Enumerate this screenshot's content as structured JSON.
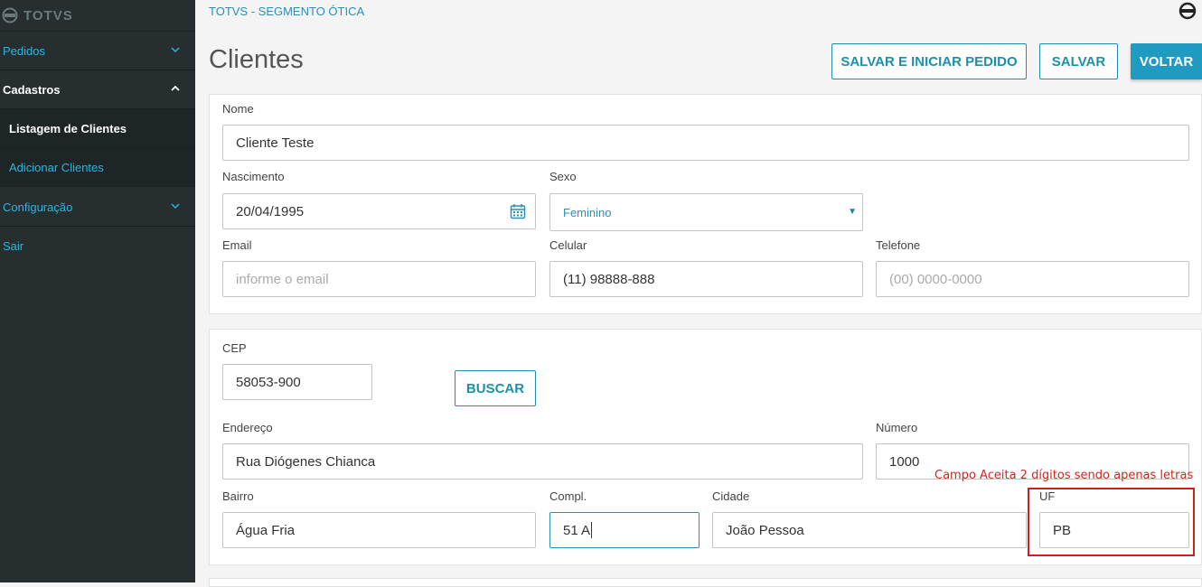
{
  "app": {
    "logo_text": "TOTVS",
    "brand": "TOTVS - SEGMENTO ÓTICA"
  },
  "sidebar": {
    "items": [
      {
        "label": "Pedidos"
      },
      {
        "label": "Cadastros"
      },
      {
        "label": "Listagem de Clientes"
      },
      {
        "label": "Adicionar Clientes"
      },
      {
        "label": "Configuração"
      },
      {
        "label": "Sair"
      }
    ]
  },
  "page": {
    "title": "Clientes"
  },
  "actions": {
    "save_and_start": "SALVAR E INICIAR PEDIDO",
    "save": "SALVAR",
    "back": "VOLTAR"
  },
  "form": {
    "nome": {
      "label": "Nome",
      "value": "Cliente Teste"
    },
    "nascimento": {
      "label": "Nascimento",
      "value": "20/04/1995"
    },
    "sexo": {
      "label": "Sexo",
      "value": "Feminino"
    },
    "email": {
      "label": "Email",
      "placeholder": "informe o email"
    },
    "celular": {
      "label": "Celular",
      "value": "(11) 98888-888"
    },
    "telefone": {
      "label": "Telefone",
      "placeholder": "(00) 0000-0000"
    },
    "cep": {
      "label": "CEP",
      "value": "58053-900",
      "button": "BUSCAR"
    },
    "endereco": {
      "label": "Endereço",
      "value": "Rua Diógenes Chianca"
    },
    "numero": {
      "label": "Número",
      "value": "1000"
    },
    "bairro": {
      "label": "Bairro",
      "value": "Água Fria"
    },
    "compl": {
      "label": "Compl.",
      "value": "51 A"
    },
    "cidade": {
      "label": "Cidade",
      "value": "João Pessoa"
    },
    "uf": {
      "label": "UF",
      "value": "PB"
    }
  },
  "annotation": {
    "text": "Campo Aceita  2 dígitos sendo apenas letras"
  },
  "colors": {
    "sidebar_bg": "#262e30",
    "accent": "#1f9ac0",
    "annotation": "#cc1f1f"
  }
}
